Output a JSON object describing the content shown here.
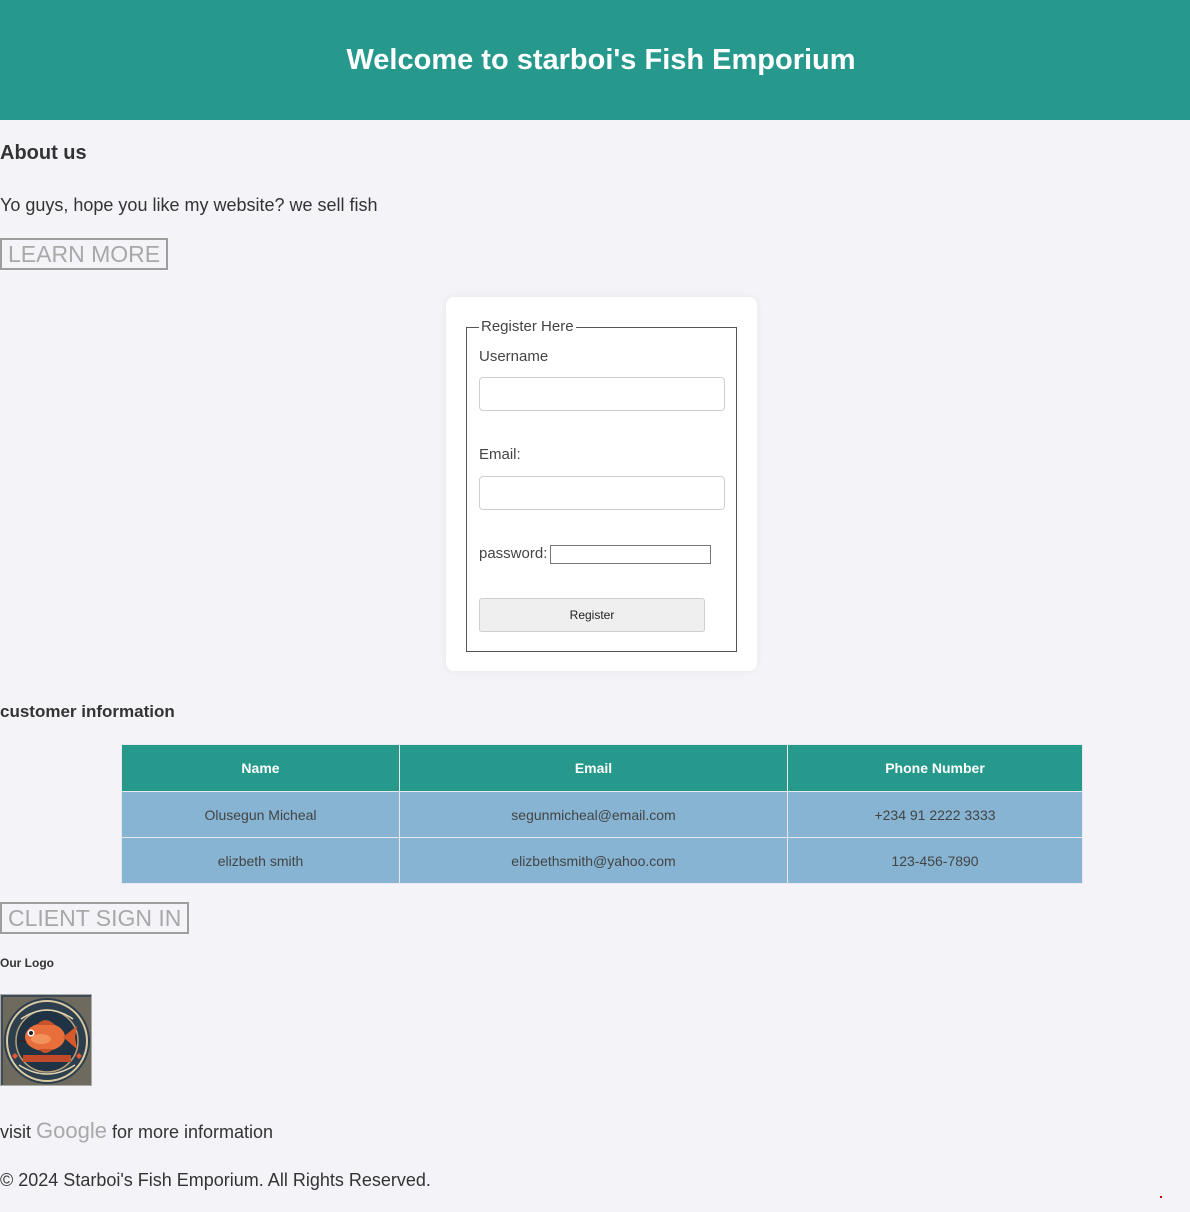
{
  "header": {
    "title": "Welcome to starboi's Fish Emporium"
  },
  "colors": {
    "header_bg": "#26998c",
    "table_header_bg": "#26998c",
    "table_row_bg": "#86b4d2",
    "page_bg": "#f4f4f8"
  },
  "about": {
    "heading": "About us",
    "text": "Yo guys, hope you like my website? we sell fish",
    "learn_more_label": "LEARN MORE"
  },
  "register_form": {
    "legend": "Register Here",
    "username_label": "Username",
    "username_value": "",
    "email_label": "Email:",
    "email_value": "",
    "password_label": "password:",
    "password_value": "",
    "submit_label": "Register"
  },
  "customers": {
    "heading": "customer information",
    "columns": [
      "Name",
      "Email",
      "Phone Number"
    ],
    "rows": [
      [
        "Olusegun Micheal",
        "segunmicheal@email.com",
        "+234 91 2222 3333"
      ],
      [
        "elizbeth smith",
        "elizbethsmith@yahoo.com",
        "123-456-7890"
      ]
    ]
  },
  "client_signin_label": "CLIENT SIGN IN",
  "logo_section": {
    "heading": "Our Logo",
    "logo_icon": "fish-logo-icon"
  },
  "visit": {
    "prefix": "visit",
    "link_text": "Google",
    "suffix": "for more information"
  },
  "footer": {
    "text": "© 2024 Starboi's Fish Emporium. All Rights Reserved."
  }
}
